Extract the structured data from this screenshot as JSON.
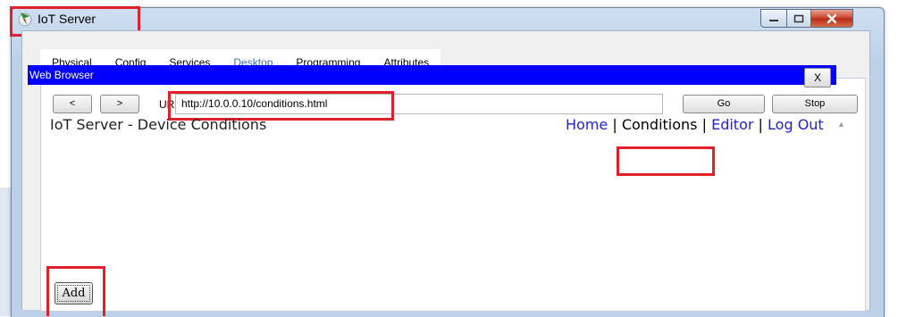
{
  "window": {
    "title": "IoT Server"
  },
  "titlebar": {
    "min_icon": "minimize-icon",
    "max_icon": "maximize-icon",
    "close_icon": "close-icon"
  },
  "tabs": [
    {
      "label": "Physical",
      "active": false
    },
    {
      "label": "Config",
      "active": false
    },
    {
      "label": "Services",
      "active": false
    },
    {
      "label": "Desktop",
      "active": true
    },
    {
      "label": "Programming",
      "active": false
    },
    {
      "label": "Attributes",
      "active": false
    }
  ],
  "browser": {
    "title": "Web Browser",
    "close_label": "X",
    "back_label": "<",
    "forward_label": ">",
    "url_label": "URL",
    "url_value": "http://10.0.0.10/conditions.html",
    "go_label": "Go",
    "stop_label": "Stop"
  },
  "page": {
    "title": "IoT Server - Device Conditions",
    "nav": {
      "home": "Home",
      "sep": "|",
      "conditions": "Conditions",
      "editor": "Editor",
      "logout": "Log Out"
    },
    "add_label": "Add"
  },
  "colors": {
    "highlight": "#e0202a",
    "browser_bar": "#0000ff",
    "link": "#2323d6",
    "active_tab": "#3d9be0"
  }
}
